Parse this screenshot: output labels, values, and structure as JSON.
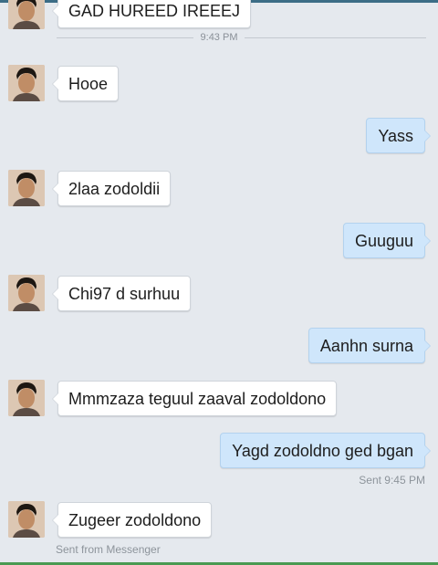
{
  "conversation": {
    "first_message": "GAD HUREED IREEEJ",
    "time_divider": "9:43 PM",
    "messages": [
      {
        "direction": "in",
        "text": "Hooe"
      },
      {
        "direction": "out",
        "text": "Yass"
      },
      {
        "direction": "in",
        "text": "2laa zodoldii"
      },
      {
        "direction": "out",
        "text": "Guuguu"
      },
      {
        "direction": "in",
        "text": "Chi97 d surhuu"
      },
      {
        "direction": "out",
        "text": "Aanhn surna"
      },
      {
        "direction": "in",
        "text": "Mmmzaza teguul zaaval zodoldono"
      },
      {
        "direction": "out",
        "text": "Yagd zodoldno ged bgan"
      },
      {
        "direction": "in",
        "text": "Zugeer zodoldono"
      }
    ],
    "sent_status": "Sent 9:45 PM",
    "footer": "Sent from Messenger"
  },
  "colors": {
    "background": "#e5e9ee",
    "incoming_bubble": "#ffffff",
    "outgoing_bubble": "#cfe6fb"
  },
  "icons": {
    "avatar": "contact-avatar-photo"
  }
}
